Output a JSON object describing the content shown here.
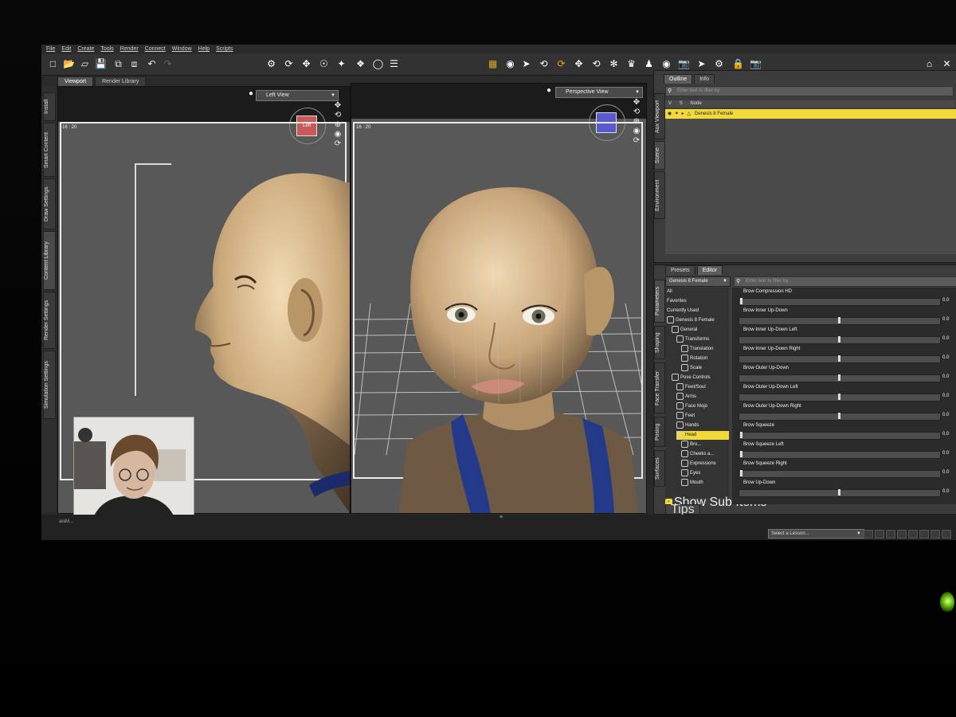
{
  "menu": [
    "File",
    "Edit",
    "Create",
    "Tools",
    "Render",
    "Connect",
    "Window",
    "Help",
    "Scripts"
  ],
  "doc_tabs": [
    {
      "label": "Viewport"
    },
    {
      "label": "Render Library"
    }
  ],
  "left_tabs": [
    "Install",
    "Smart Content",
    "Draw Settings",
    "Content Library",
    "Render Settings",
    "Simulation Settings"
  ],
  "left_viewport": {
    "view": "Left View",
    "ratio": "16 : 20",
    "cube_label": "Left"
  },
  "right_viewport": {
    "view": "Perspective View",
    "ratio": "16 : 20"
  },
  "scene_panel": {
    "tabs": [
      "Outline",
      "Info"
    ],
    "filter_placeholder": "Enter text to filter by",
    "column_v": "V",
    "column_s": "S",
    "column_node": "Node",
    "node": "Genesis 8 Female",
    "side_tabs": [
      "Aux Viewport",
      "Scene",
      "Environment"
    ]
  },
  "params_panel": {
    "tabs": [
      "Presets",
      "Editor"
    ],
    "figure_select": "Genesis 8 Female",
    "filter_placeholder": "Enter text to filter by",
    "side_tabs": [
      "Parameters",
      "Shaping",
      "Face Transfer",
      "Posing",
      "Surfaces"
    ],
    "tree": [
      {
        "label": "All",
        "depth": 0
      },
      {
        "label": "Favorites",
        "depth": 0
      },
      {
        "label": "Currently Used",
        "depth": 0
      },
      {
        "label": "Genesis 8 Female",
        "depth": 0,
        "icon": true
      },
      {
        "label": "General",
        "depth": 1,
        "icon": true
      },
      {
        "label": "Transforms",
        "depth": 2,
        "icon": true
      },
      {
        "label": "Translation",
        "depth": 3,
        "icon": true
      },
      {
        "label": "Rotation",
        "depth": 3,
        "icon": true
      },
      {
        "label": "Scale",
        "depth": 3,
        "icon": true
      },
      {
        "label": "Pose Controls",
        "depth": 1,
        "icon": true
      },
      {
        "label": "Feet/Soul",
        "depth": 2,
        "icon": true
      },
      {
        "label": "Arms",
        "depth": 2,
        "icon": true
      },
      {
        "label": "Face Mojo",
        "depth": 2,
        "icon": true
      },
      {
        "label": "Feet",
        "depth": 2,
        "icon": true
      },
      {
        "label": "Hands",
        "depth": 2,
        "icon": true
      },
      {
        "label": "Head",
        "depth": 2,
        "icon": true,
        "highlight": true
      },
      {
        "label": "Bro...",
        "depth": 3,
        "icon": true
      },
      {
        "label": "Cheeks a...",
        "depth": 3,
        "icon": true
      },
      {
        "label": "Expressions",
        "depth": 3,
        "icon": true
      },
      {
        "label": "Eyes",
        "depth": 3,
        "icon": true
      },
      {
        "label": "Mouth",
        "depth": 3,
        "icon": true
      }
    ],
    "show_sub_items": "Show Sub Items",
    "sliders": [
      {
        "label": "Brow Compression HD",
        "value": 0.0,
        "text": "0.0"
      },
      {
        "label": "Brow Inner Up-Down",
        "value": 0.5,
        "text": "0.0"
      },
      {
        "label": "Brow Inner Up-Down Left",
        "value": 0.5,
        "text": "0.0"
      },
      {
        "label": "Brow Inner Up-Down Right",
        "value": 0.5,
        "text": "0.0"
      },
      {
        "label": "Brow Outer Up-Down",
        "value": 0.5,
        "text": "0.0"
      },
      {
        "label": "Brow Outer Up-Down Left",
        "value": 0.5,
        "text": "0.0"
      },
      {
        "label": "Brow Outer Up-Down Right",
        "value": 0.5,
        "text": "0.0"
      },
      {
        "label": "Brow Squeeze",
        "value": 0.0,
        "text": "0.0"
      },
      {
        "label": "Brow Squeeze Left",
        "value": 0.0,
        "text": "0.0"
      },
      {
        "label": "Brow Squeeze Right",
        "value": 0.0,
        "text": "0.0"
      },
      {
        "label": "Brow Up-Down",
        "value": 0.5,
        "text": "0.0"
      }
    ],
    "tips_tab": "Tips"
  },
  "bottom": {
    "left_label": "aniM...",
    "lesson_select": "Select a Lesson..."
  },
  "colors": {
    "accent": "#f1d93a",
    "ui_bg": "#3c3c3c",
    "viewport": "#585858"
  }
}
